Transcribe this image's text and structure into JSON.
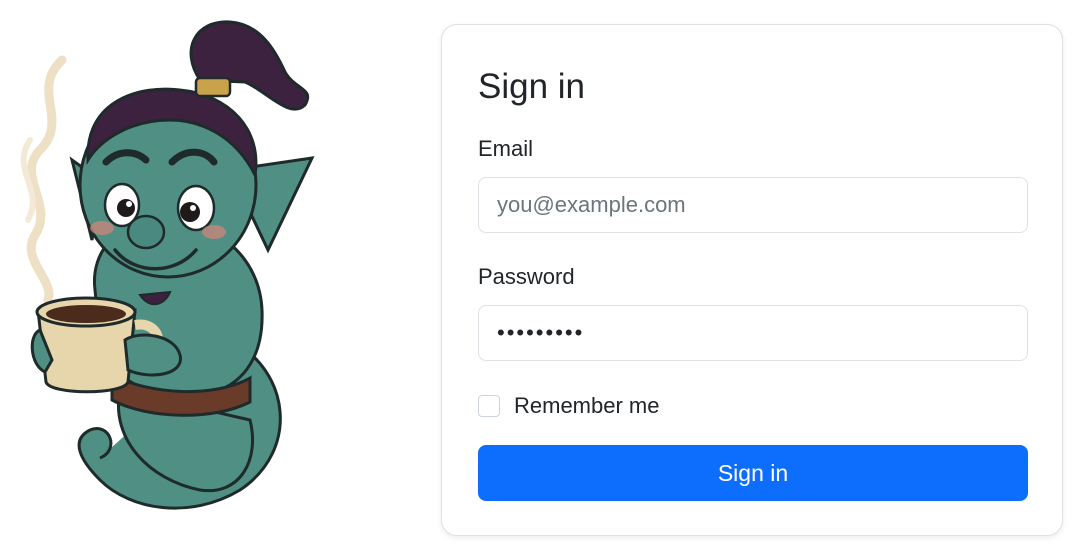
{
  "mascot": {
    "icon": "genie-with-coffee-cup-icon"
  },
  "login": {
    "title": "Sign in",
    "email_label": "Email",
    "email_placeholder": "you@example.com",
    "email_value": "",
    "password_label": "Password",
    "password_value": "passwords",
    "remember_label": "Remember me",
    "remember_checked": false,
    "submit_label": "Sign in"
  },
  "colors": {
    "primary": "#0d6efd",
    "genie_skin": "#4f8f84",
    "genie_hair": "#3d2240",
    "text": "#212529",
    "border": "#dee2e6"
  }
}
